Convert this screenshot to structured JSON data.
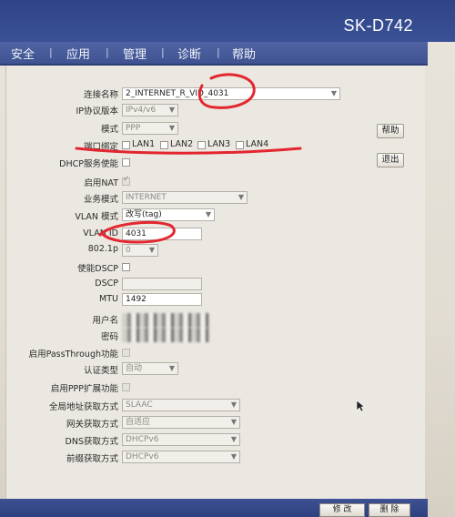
{
  "header": {
    "brand": "SK-D742"
  },
  "nav": {
    "items": [
      "安全",
      "应用",
      "管理",
      "诊断",
      "帮助"
    ],
    "separator": "|"
  },
  "form": {
    "connection_name": {
      "label": "连接名称",
      "value": "2_INTERNET_R_VID_4031"
    },
    "ip_version": {
      "label": "IP协议版本",
      "value": "IPv4/v6"
    },
    "mode": {
      "label": "模式",
      "value": "PPP"
    },
    "port_binding": {
      "label": "端口绑定",
      "ports": [
        "LAN1",
        "LAN2",
        "LAN3",
        "LAN4"
      ]
    },
    "dhcp_enable": {
      "label": "DHCP服务使能"
    },
    "nat_enable": {
      "label": "启用NAT",
      "checked": true
    },
    "service_mode": {
      "label": "业务模式",
      "value": "INTERNET"
    },
    "vlan_mode": {
      "label": "VLAN 模式",
      "value": "改写(tag)"
    },
    "vlan_id": {
      "label": "VLAN ID",
      "value": "4031"
    },
    "priority_8021p": {
      "label": "802.1p",
      "value": "0"
    },
    "dscp_enable": {
      "label": "使能DSCP"
    },
    "dscp": {
      "label": "DSCP",
      "value": ""
    },
    "mtu": {
      "label": "MTU",
      "value": "1492"
    },
    "username": {
      "label": "用户名"
    },
    "password": {
      "label": "密码"
    },
    "passthrough": {
      "label": "启用PassThrough功能"
    },
    "auth_type": {
      "label": "认证类型",
      "value": "自动"
    },
    "ppp_ext": {
      "label": "启用PPP扩展功能"
    },
    "global_addr": {
      "label": "全局地址获取方式",
      "value": "SLAAC"
    },
    "gateway": {
      "label": "网关获取方式",
      "value": "自适应"
    },
    "dns": {
      "label": "DNS获取方式",
      "value": "DHCPv6"
    },
    "prefix": {
      "label": "前缀获取方式",
      "value": "DHCPv6"
    }
  },
  "side_buttons": {
    "help": "帮助",
    "exit": "退出"
  },
  "footer": {
    "modify": "修 改",
    "delete": "删 除"
  },
  "colors": {
    "header": "#2f4486",
    "navbar": "#4a5e9e",
    "annotation": "#e3262f"
  }
}
